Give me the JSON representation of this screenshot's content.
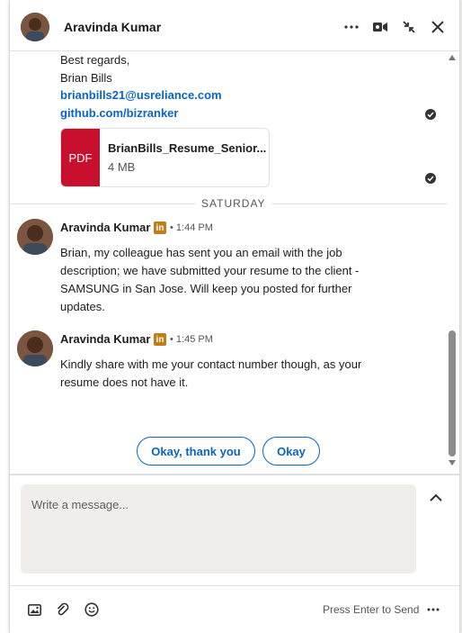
{
  "header": {
    "contact_name": "Aravinda Kumar"
  },
  "thread": {
    "signature_lines": [
      "Best regards,",
      "Brian Bills"
    ],
    "email_link": "brianbills21@usreliance.com",
    "github_link": "github.com/bizranker",
    "attachment": {
      "type_label": "PDF",
      "file_name": "BrianBills_Resume_Senior...",
      "file_size": "4 MB"
    },
    "day_divider": "SATURDAY",
    "messages": [
      {
        "sender": "Aravinda Kumar",
        "badge": "in",
        "time": "• 1:44 PM",
        "text": "Brian, my colleague has sent you an email with the job description; we have submitted your resume to the client - SAMSUNG in San Jose. Will keep you posted for further updates."
      },
      {
        "sender": "Aravinda Kumar",
        "badge": "in",
        "time": "• 1:45 PM",
        "text": "Kindly share with me your contact number though, as your resume does not have it."
      }
    ]
  },
  "suggested_replies": [
    "Okay, thank you",
    "Okay"
  ],
  "composer": {
    "placeholder": "Write a message...",
    "send_hint": "Press Enter to Send"
  },
  "colors": {
    "accent": "#0a66c2",
    "pdf_red": "#c8102e",
    "linkedin_badge": "#c37d16"
  }
}
